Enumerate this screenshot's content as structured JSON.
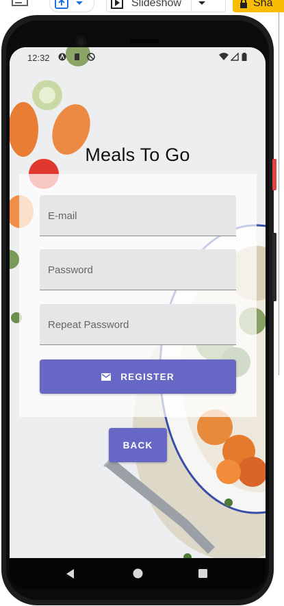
{
  "host": {
    "slideshow_label": "Slideshow",
    "share_label": "Sha"
  },
  "status_bar": {
    "time": "12:32"
  },
  "app": {
    "title": "Meals To Go"
  },
  "form": {
    "email_placeholder": "E-mail",
    "password_placeholder": "Password",
    "repeat_password_placeholder": "Repeat Password",
    "register_label": "REGISTER",
    "back_label": "BACK"
  },
  "colors": {
    "button": "#6768c6",
    "field": "#e6e6e6"
  }
}
